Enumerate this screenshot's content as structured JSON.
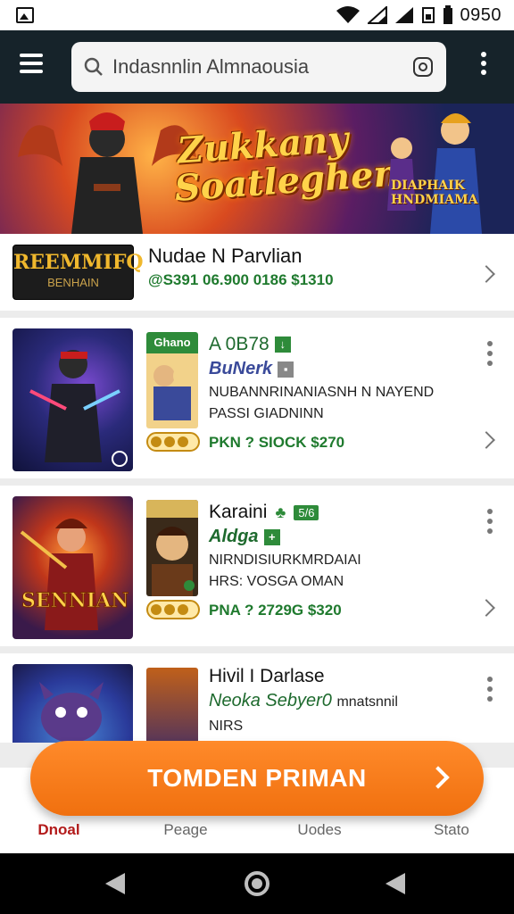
{
  "status_bar": {
    "time": "0950"
  },
  "app_bar": {
    "search": {
      "value": "Indasnnlin Almnaousia",
      "placeholder": "Indasnnlin Almnaousia"
    }
  },
  "banner": {
    "title_line1": "Zukkany",
    "title_line2": "Soatleghen",
    "badge_line1": "DIAPHAIK",
    "badge_line2": "HNDMIAMA"
  },
  "featured": {
    "logo_line1": "REEMMIFQ",
    "logo_line2": "BENHAIN",
    "title": "Nudae N Parvlian",
    "meta": "@S391 06.900 0186 $1310"
  },
  "cards": [
    {
      "mini_label": "Ghano",
      "title": "A 0B78",
      "subtitle": "BuNerk",
      "desc1": "NUBANNRINANIASNH N NAYEND",
      "desc2": "PASSI GIADNINN",
      "rating_label": "",
      "meta": "PKN ? SIOCK $270"
    },
    {
      "mini_label": "",
      "title": "Karaini",
      "subtitle": "Aldga",
      "desc1": "NIRNDISIURKMRDAIAI",
      "desc2": "HRS: VOSGA OMAN",
      "rating_label": "",
      "meta": "PNA ? 2729G $320",
      "thumb_text": "SENNIAN"
    },
    {
      "mini_label": "",
      "title": "Hivil I Darlase",
      "subtitle": "Neoka Sebyer0",
      "subtitle_extra": "mnatsnnil",
      "desc1": "NIRS"
    }
  ],
  "cta": {
    "label": "TOMDEN PRIMAN"
  },
  "bottom_nav": {
    "items": [
      "Dnoal",
      "Peage",
      "Uodes",
      "Stato"
    ]
  },
  "colors": {
    "app_bar": "#16232a",
    "cta": "#f0700f",
    "price_green": "#1f7a2e",
    "active_nav": "#b31b1b"
  }
}
